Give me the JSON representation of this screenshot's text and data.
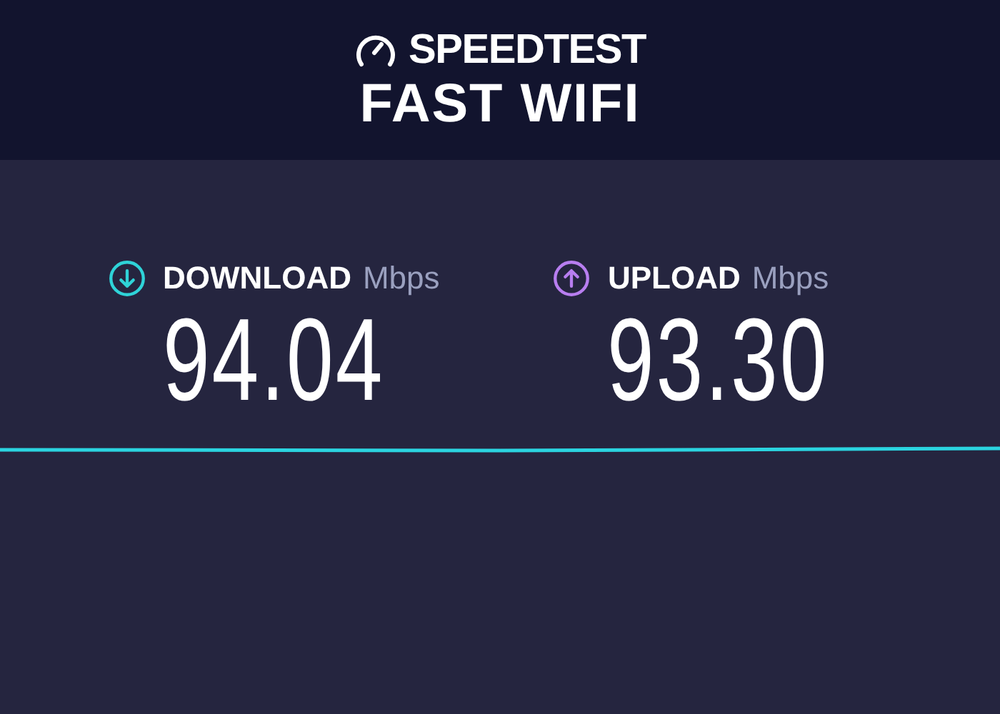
{
  "header": {
    "logo": "SPEEDTEST",
    "title": "FAST WIFI"
  },
  "metrics": [
    {
      "kind": "download",
      "label": "DOWNLOAD",
      "unit": "Mbps",
      "value": "94.04",
      "color": "#2fd3d8"
    },
    {
      "kind": "upload",
      "label": "UPLOAD",
      "unit": "Mbps",
      "value": "93.30",
      "color": "#b87ef0"
    }
  ]
}
